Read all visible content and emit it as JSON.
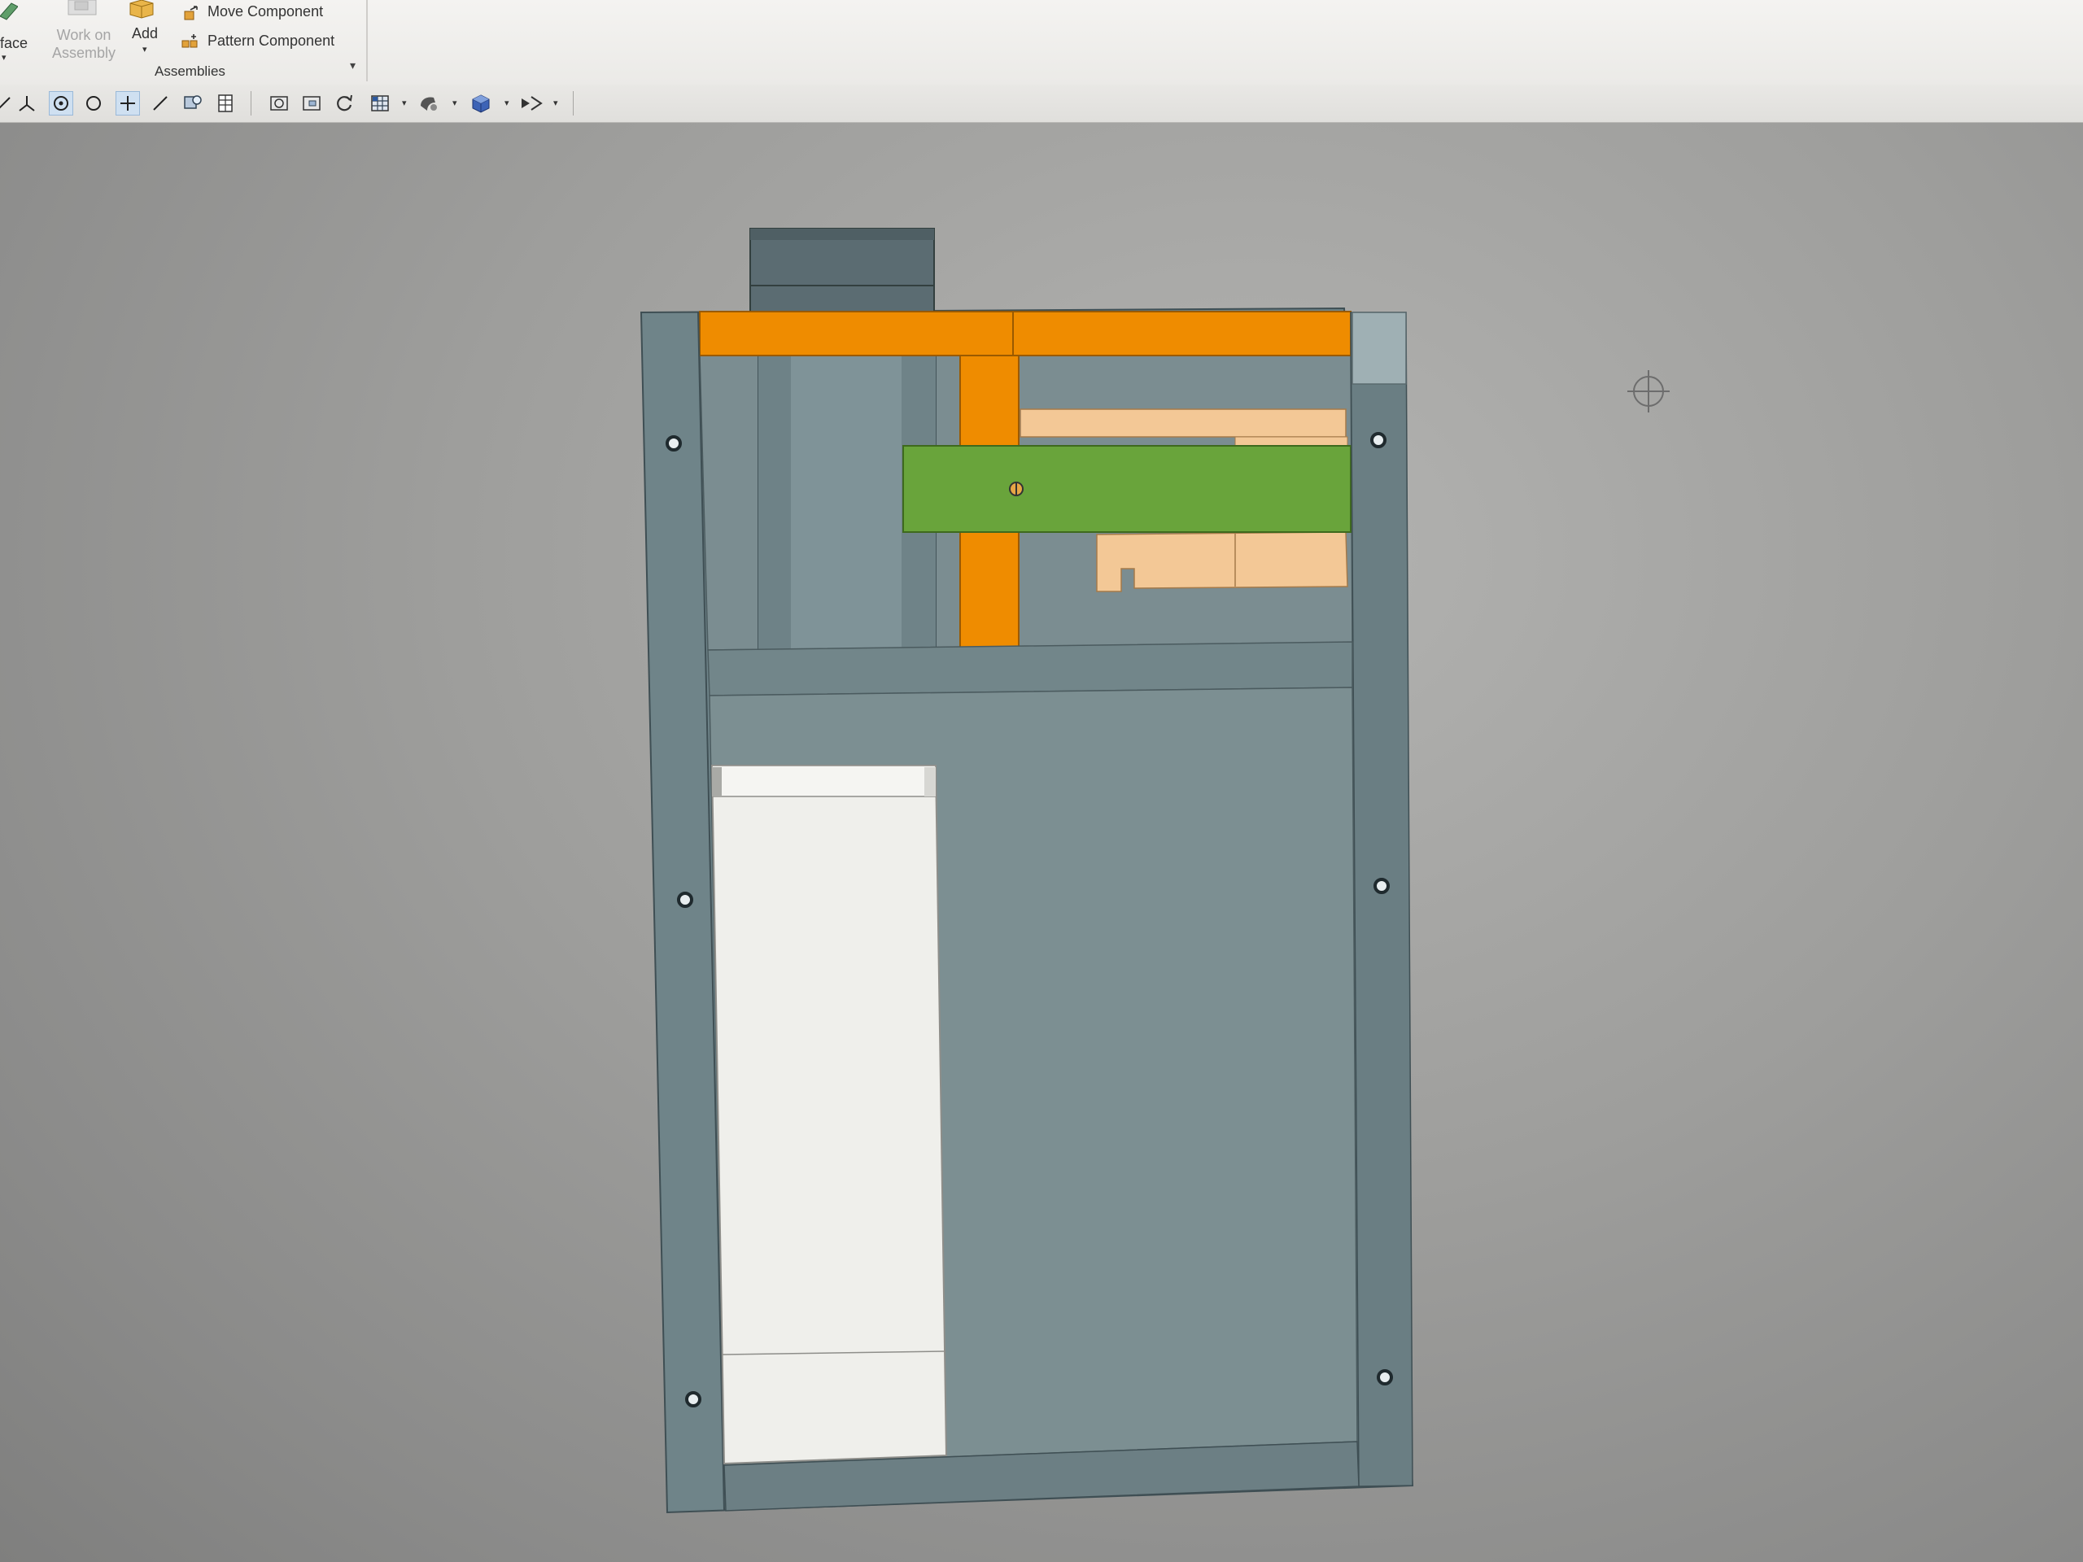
{
  "ribbon": {
    "surface_label": "face",
    "work_on_assembly": {
      "line1": "Work on",
      "line2": "Assembly"
    },
    "add_label": "Add",
    "move_component_label": "Move Component",
    "pattern_component_label": "Pattern Component",
    "group_caption": "Assemblies"
  },
  "toolbar": {
    "tools": [
      "select-icon",
      "axis-icon",
      "snap-circle-icon",
      "circle-icon",
      "point-icon",
      "line-icon",
      "measure-icon",
      "table-icon",
      "zoom-fit-icon",
      "zoom-window-icon",
      "rotate-icon",
      "view-grid-icon",
      "render-style-icon",
      "display-cube-icon",
      "section-icon"
    ],
    "active_tools": [
      "snap-circle-icon",
      "point-icon"
    ]
  },
  "colors": {
    "frame": "#6f8489",
    "frame_dark": "#5f7378",
    "panel": "#7e9194",
    "orange": "#ef8c00",
    "green": "#69a43b",
    "peach": "#f3c896",
    "white_part": "#efefeb"
  }
}
